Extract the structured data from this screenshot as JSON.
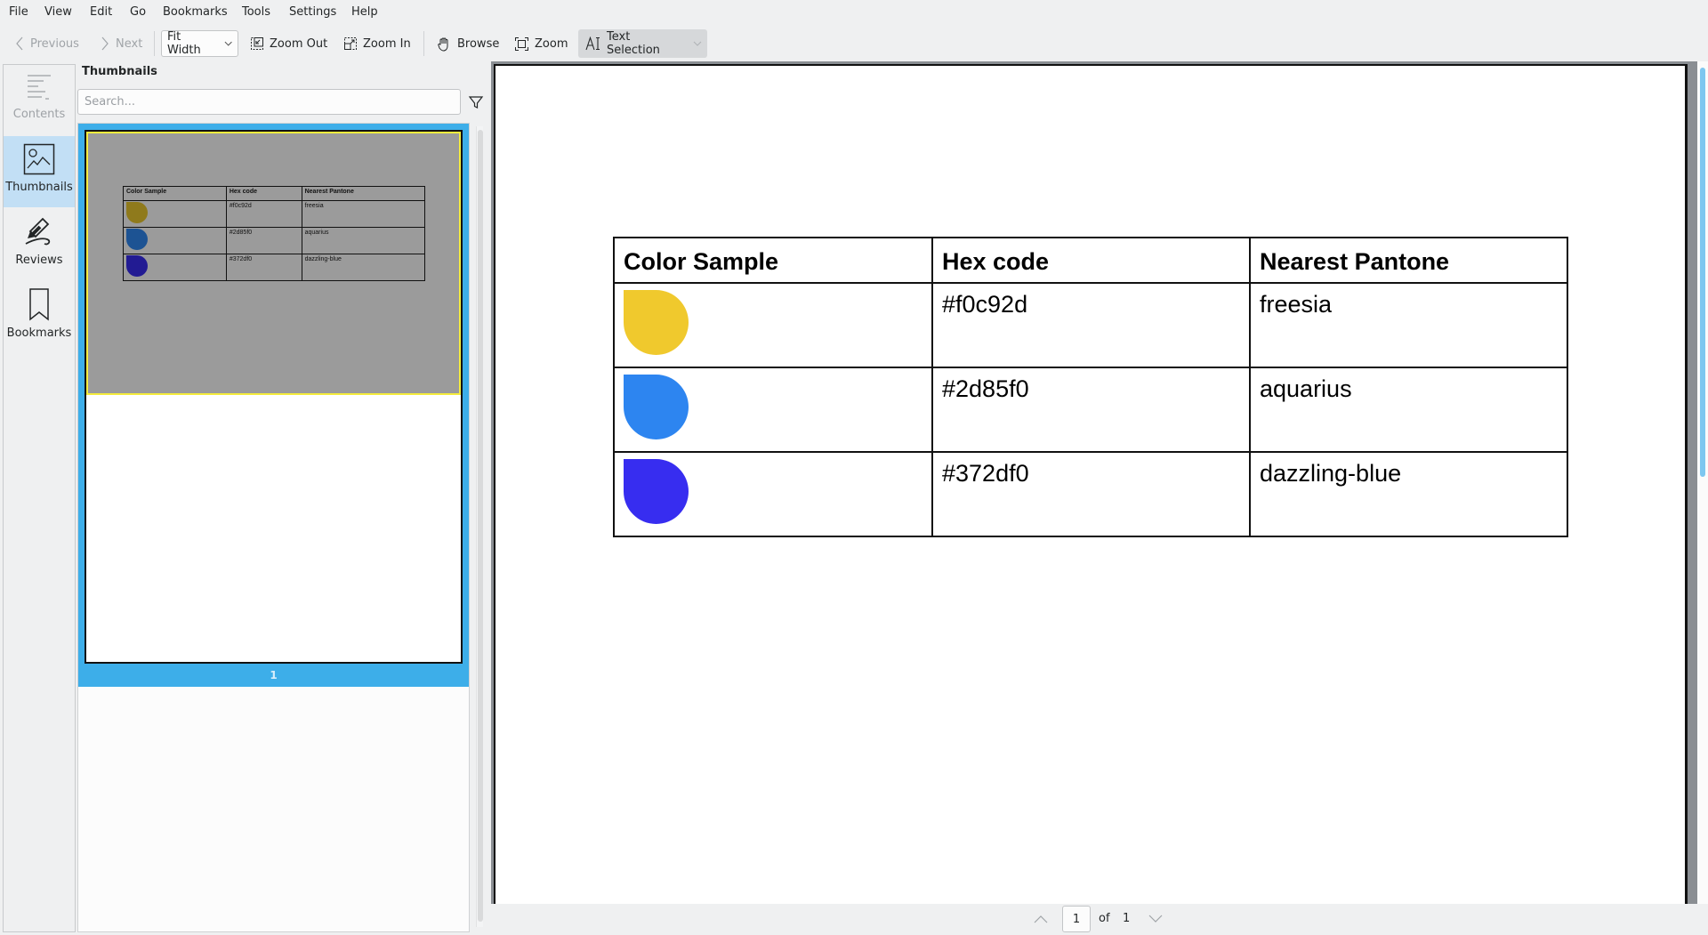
{
  "menubar": {
    "items": [
      "File",
      "View",
      "Edit",
      "Go",
      "Bookmarks",
      "Tools",
      "Settings",
      "Help"
    ]
  },
  "toolbar": {
    "previous_label": "Previous",
    "next_label": "Next",
    "zoom_mode": "Fit Width",
    "zoom_out_label": "Zoom Out",
    "zoom_in_label": "Zoom In",
    "browse_label": "Browse",
    "zoom_label": "Zoom",
    "text_selection_label": "Text Selection"
  },
  "sidebar": {
    "items": [
      {
        "label": "Contents",
        "icon": "contents-icon",
        "state": "disabled"
      },
      {
        "label": "Thumbnails",
        "icon": "thumbnails-icon",
        "state": "selected"
      },
      {
        "label": "Reviews",
        "icon": "reviews-icon",
        "state": "normal"
      },
      {
        "label": "Bookmarks",
        "icon": "bookmarks-icon",
        "state": "normal"
      }
    ]
  },
  "thumbnails_panel": {
    "title": "Thumbnails",
    "search_placeholder": "Search...",
    "search_value": "",
    "pages": [
      {
        "number": "1"
      }
    ]
  },
  "document": {
    "table": {
      "headers": [
        "Color Sample",
        "Hex code",
        "Nearest Pantone"
      ],
      "rows": [
        {
          "swatch_color": "#f0c92d",
          "hex": "#f0c92d",
          "pantone": "freesia"
        },
        {
          "swatch_color": "#2d85f0",
          "hex": "#2d85f0",
          "pantone": "aquarius"
        },
        {
          "swatch_color": "#372df0",
          "hex": "#372df0",
          "pantone": "dazzling-blue"
        }
      ]
    }
  },
  "page_nav": {
    "current_page": "1",
    "of_label": "of",
    "total_pages": "1"
  },
  "colors": {
    "accent": "#3daee9",
    "selection_bg": "#c2dff5",
    "thumbnail_visible_area": "#9b9b9b",
    "thumbnail_visible_border": "#f5ec3d"
  }
}
